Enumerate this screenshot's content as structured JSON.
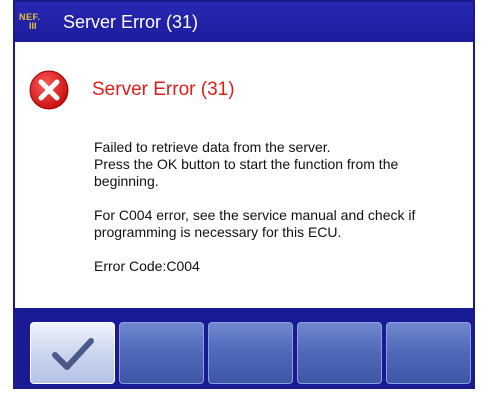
{
  "window": {
    "title": "Server Error (31)",
    "logo_top": "NEF.",
    "logo_bottom": "III"
  },
  "dialog": {
    "icon": "error-x-icon",
    "heading": "Server Error (31)",
    "paragraphs": [
      "Failed to retrieve data from the server.\nPress the OK button to start the function from the beginning.",
      "For C004 error, see the service manual and check if programming is necessary for this ECU.",
      "Error Code:C004"
    ]
  },
  "buttons": [
    {
      "label": "",
      "icon": "checkmark-icon"
    },
    {
      "label": ""
    },
    {
      "label": ""
    },
    {
      "label": ""
    },
    {
      "label": ""
    }
  ],
  "colors": {
    "titlebar": "#1c1c9c",
    "heading": "#e01c1c",
    "error_icon": "#e02020",
    "button_bar": "#1a1a94"
  }
}
